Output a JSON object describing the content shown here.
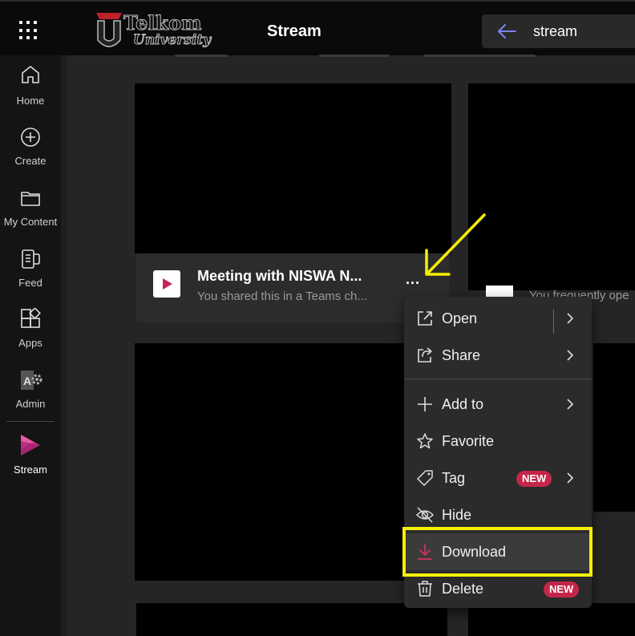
{
  "header": {
    "logo": {
      "line1": "Telkom",
      "line2": "University"
    },
    "app_title": "Stream",
    "search": {
      "value": "stream"
    }
  },
  "rail": {
    "items": [
      {
        "label": "Home",
        "icon": "home-icon"
      },
      {
        "label": "Create",
        "icon": "plus-circle-icon"
      },
      {
        "label": "My Content",
        "icon": "folder-icon"
      },
      {
        "label": "Feed",
        "icon": "feed-icon"
      },
      {
        "label": "Apps",
        "icon": "apps-icon"
      },
      {
        "label": "Admin",
        "icon": "admin-icon"
      },
      {
        "label": "Stream",
        "icon": "stream-logo-icon",
        "active": true
      }
    ]
  },
  "card": {
    "title": "Meeting with NISWA N...",
    "subtitle": "You shared this in a Teams ch...",
    "more": "..."
  },
  "right_card": {
    "subtitle": "You frequently ope"
  },
  "menu": {
    "items": [
      {
        "label": "Open",
        "icon": "open-external-icon",
        "submenu": true
      },
      {
        "label": "Share",
        "icon": "share-icon",
        "submenu": true
      },
      {
        "label": "Add to",
        "icon": "plus-icon",
        "submenu": true
      },
      {
        "label": "Favorite",
        "icon": "star-icon"
      },
      {
        "label": "Tag",
        "icon": "tag-icon",
        "badge": "NEW",
        "submenu": true
      },
      {
        "label": "Hide",
        "icon": "eye-off-icon"
      },
      {
        "label": "Download",
        "icon": "download-icon",
        "highlighted": true
      },
      {
        "label": "Delete",
        "icon": "trash-icon",
        "badge": "NEW"
      }
    ]
  },
  "colors": {
    "accent": "#c4265a",
    "annotation": "#f4f000",
    "badge": "#c4264a"
  }
}
